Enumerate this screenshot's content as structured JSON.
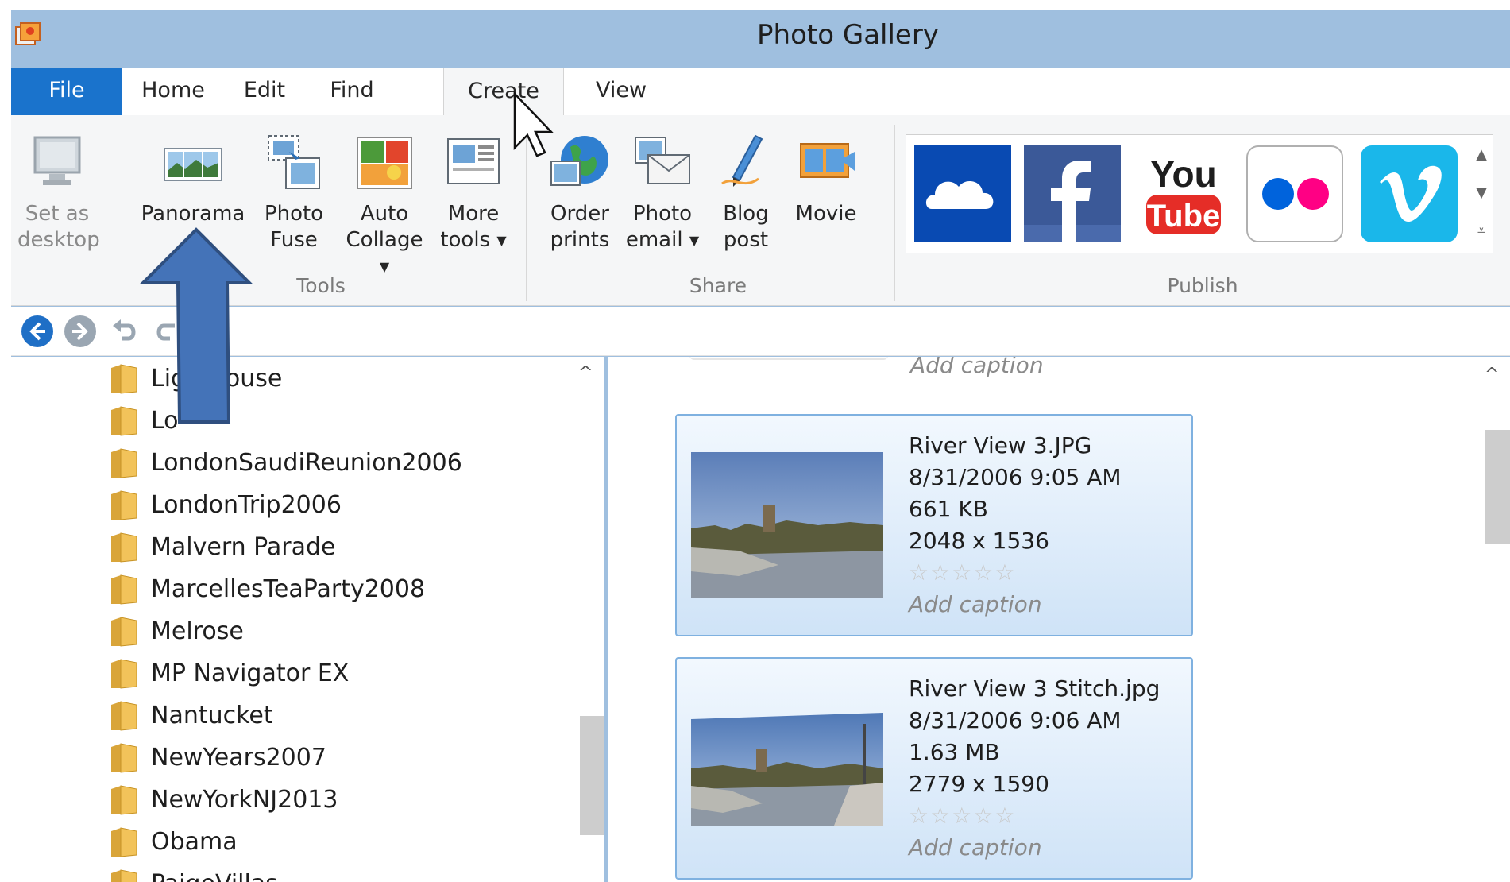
{
  "window": {
    "title": "Photo Gallery"
  },
  "tabs": [
    "File",
    "Home",
    "Edit",
    "Find",
    "Create",
    "View"
  ],
  "ribbon": {
    "set_desktop": {
      "line1": "Set as",
      "line2": "desktop"
    },
    "panorama": {
      "line1": "Panorama"
    },
    "photo_fuse": {
      "line1": "Photo",
      "line2": "Fuse"
    },
    "auto_collage": {
      "line1": "Auto",
      "line2": "Collage"
    },
    "more_tools": {
      "line1": "More",
      "line2": "tools"
    },
    "order_prints": {
      "line1": "Order",
      "line2": "prints"
    },
    "photo_email": {
      "line1": "Photo",
      "line2": "email"
    },
    "blog_post": {
      "line1": "Blog",
      "line2": "post"
    },
    "movie": {
      "line1": "Movie"
    },
    "groups": {
      "tools": "Tools",
      "share": "Share",
      "publish": "Publish"
    },
    "publish_services": [
      "onedrive-icon",
      "facebook-icon",
      "youtube-icon",
      "flickr-icon",
      "vimeo-icon"
    ],
    "youtube_text": {
      "top": "You",
      "bottom": "Tube"
    }
  },
  "folders": [
    "Lighthouse",
    "Lo",
    "LondonSaudiReunion2006",
    "LondonTrip2006",
    "Malvern Parade",
    "MarcellesTeaParty2008",
    "Melrose",
    "MP Navigator EX",
    "Nantucket",
    "NewYears2007",
    "NewYorkNJ2013",
    "Obama",
    "PaigeVillas"
  ],
  "content": {
    "top_caption": "Add caption",
    "photos": [
      {
        "name": "River View 3.JPG",
        "date": "8/31/2006 9:05 AM",
        "size": "661 KB",
        "dimensions": "2048 x 1536",
        "rating": 0,
        "caption": "Add caption"
      },
      {
        "name": "River View 3 Stitch.jpg",
        "date": "8/31/2006 9:06 AM",
        "size": "1.63 MB",
        "dimensions": "2779 x 1590",
        "rating": 0,
        "caption": "Add caption"
      }
    ]
  },
  "colors": {
    "titlebar": "#9fbfdf",
    "file_tab": "#1a73cc",
    "annotation_arrow": "#3f6db3",
    "onedrive": "#094ab2",
    "facebook": "#3b5998",
    "youtube": "#e52d27",
    "flickr_blue": "#0063dc",
    "flickr_pink": "#ff0084",
    "vimeo": "#1ab7ea"
  }
}
